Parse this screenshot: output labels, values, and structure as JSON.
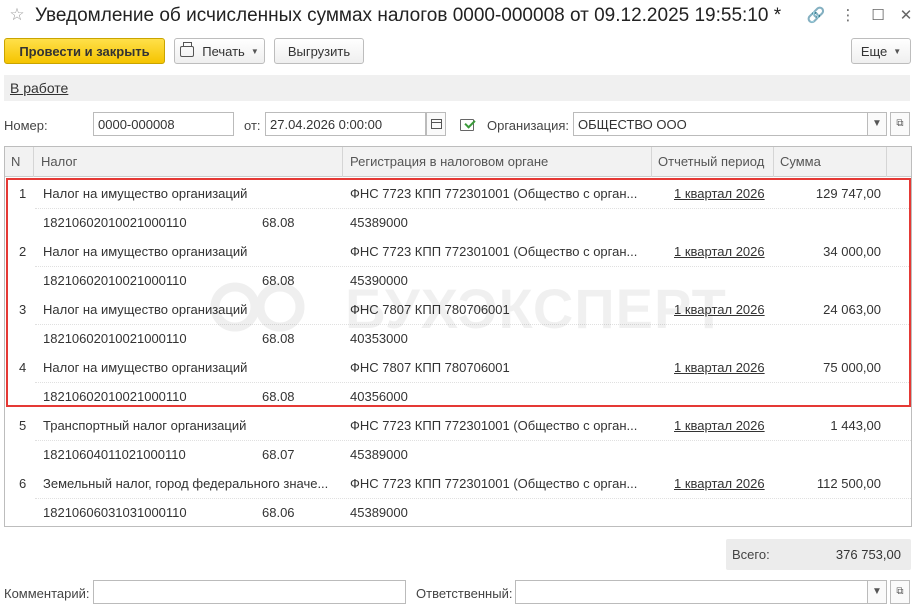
{
  "window": {
    "title": "Уведомление об исчисленных суммах налогов 0000-000008 от 09.12.2025 19:55:10 *"
  },
  "toolbar": {
    "post_close": "Провести и закрыть",
    "print": "Печать",
    "export": "Выгрузить",
    "more": "Еще"
  },
  "status": {
    "text": "В работе"
  },
  "header": {
    "number_label": "Номер:",
    "number_value": "0000-000008",
    "date_label": "от:",
    "date_value": "27.04.2026  0:00:00",
    "org_label": "Организация:",
    "org_value": "ОБЩЕСТВО ООО"
  },
  "table": {
    "columns": [
      "N",
      "Налог",
      "Регистрация в налоговом органе",
      "Отчетный период",
      "Сумма"
    ],
    "rows": [
      {
        "n": "1",
        "tax": "Налог на имущество организаций",
        "kbk": "18210602010021000110",
        "account": "68.08",
        "reg": "ФНС 7723 КПП 772301001 (Общество с орган...",
        "oktmo": "45389000",
        "period": "1 квартал 2026",
        "sum": "129 747,00"
      },
      {
        "n": "2",
        "tax": "Налог на имущество организаций",
        "kbk": "18210602010021000110",
        "account": "68.08",
        "reg": "ФНС 7723 КПП 772301001 (Общество с орган...",
        "oktmo": "45390000",
        "period": "1 квартал 2026",
        "sum": "34 000,00"
      },
      {
        "n": "3",
        "tax": "Налог на имущество организаций",
        "kbk": "18210602010021000110",
        "account": "68.08",
        "reg": "ФНС 7807 КПП 780706001",
        "oktmo": "40353000",
        "period": "1 квартал 2026",
        "sum": "24 063,00"
      },
      {
        "n": "4",
        "tax": "Налог на имущество организаций",
        "kbk": "18210602010021000110",
        "account": "68.08",
        "reg": "ФНС 7807 КПП 780706001",
        "oktmo": "40356000",
        "period": "1 квартал 2026",
        "sum": "75 000,00"
      },
      {
        "n": "5",
        "tax": "Транспортный налог организаций",
        "kbk": "18210604011021000110",
        "account": "68.07",
        "reg": "ФНС 7723 КПП 772301001 (Общество с орган...",
        "oktmo": "45389000",
        "period": "1 квартал 2026",
        "sum": "1 443,00"
      },
      {
        "n": "6",
        "tax": "Земельный налог, город федерального значе...",
        "kbk": "18210606031031000110",
        "account": "68.06",
        "reg": "ФНС 7723 КПП 772301001 (Общество с орган...",
        "oktmo": "45389000",
        "period": "1 квартал 2026",
        "sum": "112 500,00"
      }
    ]
  },
  "watermark": "БУХЭКСПЕРТ",
  "footer": {
    "total_label": "Всего:",
    "total_value": "376 753,00",
    "comment_label": "Комментарий:",
    "comment_value": "",
    "responsible_label": "Ответственный:",
    "responsible_value": ""
  },
  "colors": {
    "primary_button": "#f5c400",
    "highlight_frame": "#e53935"
  }
}
